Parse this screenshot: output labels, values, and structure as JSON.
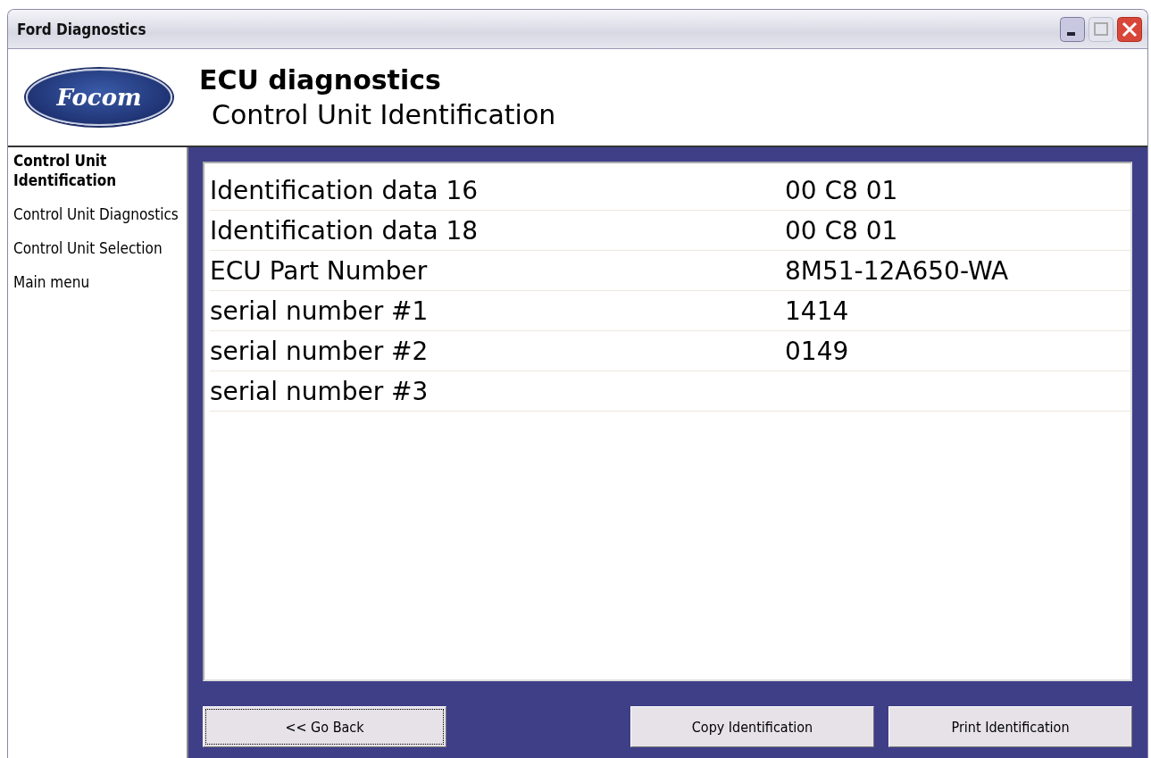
{
  "window": {
    "title": "Ford Diagnostics"
  },
  "header": {
    "logo_text": "Focom",
    "title": "ECU diagnostics",
    "subtitle": "Control Unit Identification"
  },
  "sidebar": {
    "items": [
      {
        "label": "Control Unit Identification",
        "selected": true
      },
      {
        "label": "Control Unit Diagnostics",
        "selected": false
      },
      {
        "label": "Control Unit Selection",
        "selected": false
      },
      {
        "label": "Main menu",
        "selected": false
      }
    ]
  },
  "table": {
    "rows": [
      {
        "label": "Identification data 16",
        "value": "00 C8 01"
      },
      {
        "label": "Identification data 18",
        "value": "00 C8 01"
      },
      {
        "label": "ECU Part Number",
        "value": "8M51-12A650-WA"
      },
      {
        "label": "serial number #1",
        "value": "1414"
      },
      {
        "label": "serial number #2",
        "value": "0149"
      },
      {
        "label": "serial number #3"
      }
    ]
  },
  "buttons": [
    {
      "label": "<< Go Back",
      "focused": true
    },
    {
      "label": "Copy Identification",
      "focused": false
    },
    {
      "label": "Print Identification",
      "focused": false
    }
  ]
}
